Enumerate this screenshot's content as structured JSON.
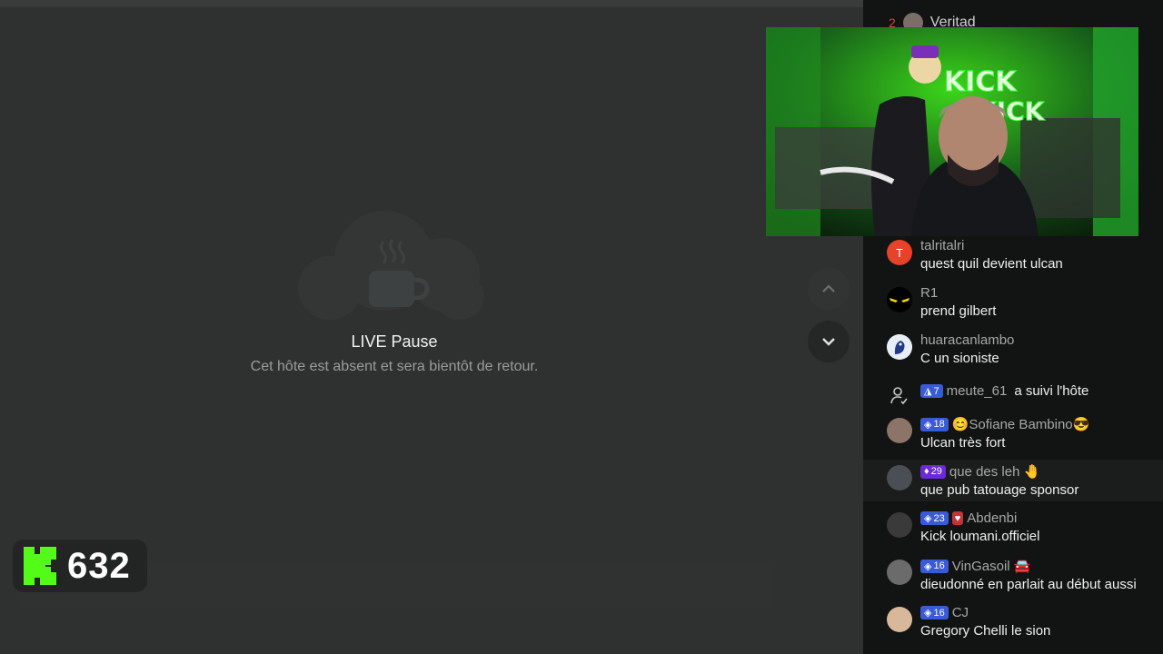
{
  "stream": {
    "live_title": "LIVE Pause",
    "live_subtitle": "Cet hôte est absent et sera bientôt de retour.",
    "viewer_count": "632"
  },
  "webcam": {
    "sign_text_1": "KICK",
    "sign_text_2": "KICK"
  },
  "chat": {
    "top_user": {
      "rank": "2",
      "name": "Veritad"
    },
    "messages": [
      {
        "avatar": "T",
        "user": "talritalri",
        "text": "quest quil devient ulcan"
      },
      {
        "user": "R1",
        "text": "prend gilbert"
      },
      {
        "user": "huaracanlambo",
        "text": "C un sioniste"
      },
      {
        "badge": "7",
        "user": "meute_61",
        "text": "a suivi l'hôte"
      },
      {
        "badge": "18",
        "user": "😊Sofiane Bambino😎",
        "text": "Ulcan très fort"
      },
      {
        "badge": "29",
        "user": "que des leh 🤚",
        "text": "que pub tatouage sponsor"
      },
      {
        "badge": "23",
        "user": "Abdenbi",
        "text": "Kick loumani.officiel"
      },
      {
        "badge": "16",
        "user": "VinGasoil 🚘",
        "text": "dieudonné en parlait au début aussi"
      },
      {
        "badge": "16",
        "user": "CJ",
        "text": "Gregory Chelli le sion"
      }
    ]
  },
  "colors": {
    "accent": "#53fc18",
    "badge_blue": "#3b5bd6",
    "badge_purple": "#6a2ad8"
  }
}
